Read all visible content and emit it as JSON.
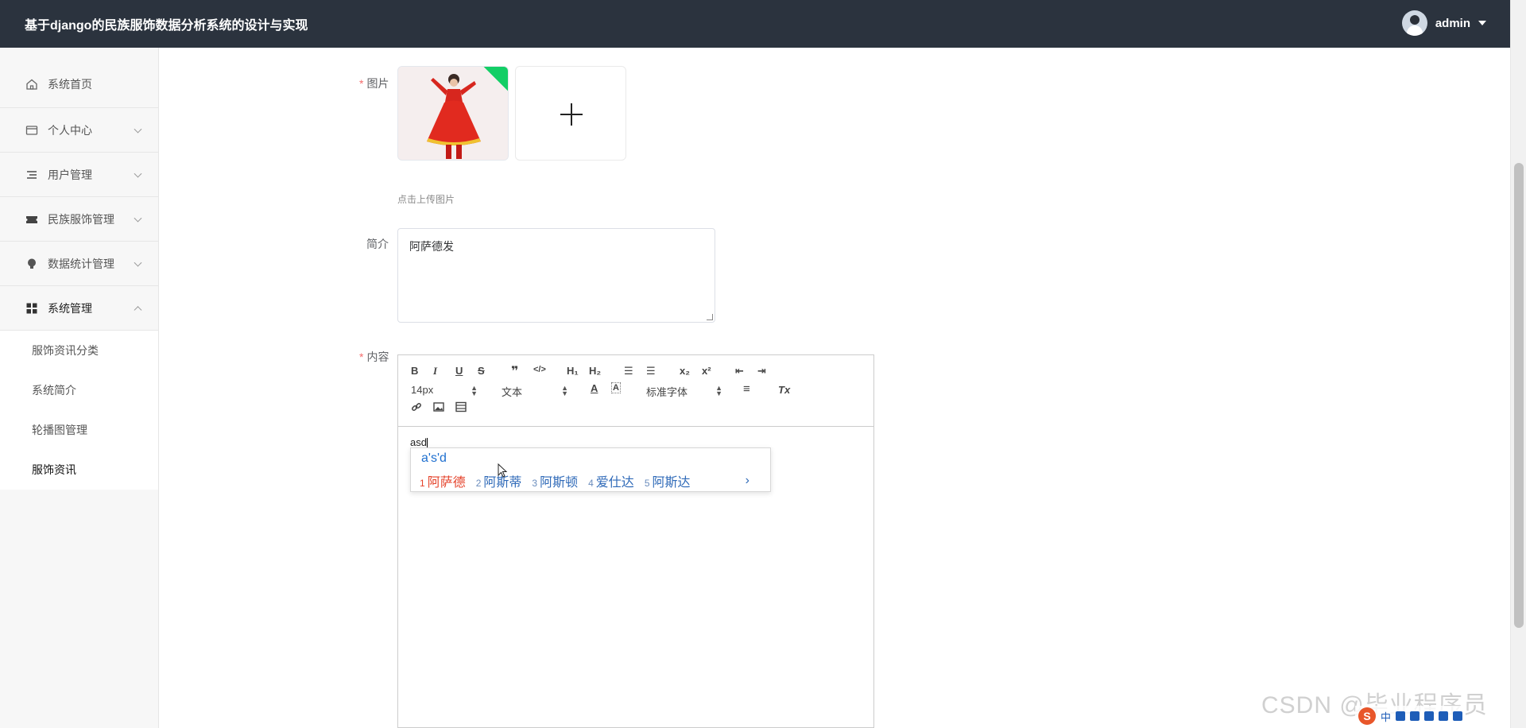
{
  "app": {
    "title": "基于django的民族服饰数据分析系统的设计与实现"
  },
  "user": {
    "name": "admin"
  },
  "sidebar": {
    "items": [
      {
        "label": "系统首页",
        "icon": "home-icon"
      },
      {
        "label": "个人中心",
        "icon": "card-icon"
      },
      {
        "label": "用户管理",
        "icon": "list-icon"
      },
      {
        "label": "民族服饰管理",
        "icon": "ticket-icon"
      },
      {
        "label": "数据统计管理",
        "icon": "bulb-icon"
      },
      {
        "label": "系统管理",
        "icon": "grid-icon"
      }
    ],
    "subitems": [
      {
        "label": "服饰资讯分类"
      },
      {
        "label": "系统简介"
      },
      {
        "label": "轮播图管理"
      },
      {
        "label": "服饰资讯"
      }
    ]
  },
  "form": {
    "image_label": "图片",
    "upload_hint": "点击上传图片",
    "intro_label": "简介",
    "intro_value": "阿萨德发",
    "content_label": "内容"
  },
  "editor": {
    "font_size": "14px",
    "block_type": "文本",
    "font_family": "标准字体",
    "content_text": "asd",
    "toolbar": {
      "bold": "B",
      "italic": "I",
      "underline": "U",
      "strike": "S",
      "blockquote": "❞",
      "code": "</>",
      "h1": "H₁",
      "h2": "H₂",
      "ordered_list": "☰",
      "bullet_list": "☰",
      "subscript": "x₂",
      "superscript": "x²",
      "outdent": "⇤",
      "indent": "⇥",
      "color": "A",
      "background": "A",
      "align": "≡",
      "clean": "Tx",
      "link": "🔗",
      "image": "▣",
      "video": "▤"
    }
  },
  "ime": {
    "input": "a's'd",
    "candidates": [
      {
        "n": "1",
        "text": "阿萨德"
      },
      {
        "n": "2",
        "text": "阿斯蒂"
      },
      {
        "n": "3",
        "text": "阿斯顿"
      },
      {
        "n": "4",
        "text": "爱仕达"
      },
      {
        "n": "5",
        "text": "阿斯达"
      }
    ],
    "more": "›"
  },
  "watermark": "CSDN @毕业程序员",
  "tray": {
    "logo": "S",
    "lang": "中"
  }
}
